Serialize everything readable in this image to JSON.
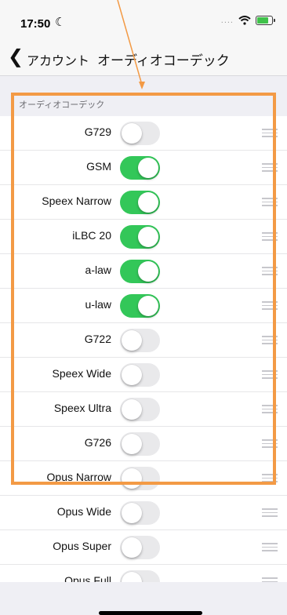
{
  "status_bar": {
    "time": "17:50",
    "moon_icon": "moon-icon",
    "signal_dots": "....",
    "wifi_icon": "wifi-icon",
    "battery_icon": "battery-icon",
    "battery_color": "#3fc14a"
  },
  "nav": {
    "back_label": "アカウント",
    "title": "オーディオコーデック"
  },
  "section": {
    "title": "オーディオコーデック"
  },
  "accent": {
    "switch_on": "#33c759",
    "highlight": "#f39a45"
  },
  "codecs": [
    {
      "name": "G729",
      "enabled": false
    },
    {
      "name": "GSM",
      "enabled": true
    },
    {
      "name": "Speex Narrow",
      "enabled": true
    },
    {
      "name": "iLBC 20",
      "enabled": true
    },
    {
      "name": "a-law",
      "enabled": true
    },
    {
      "name": "u-law",
      "enabled": true
    },
    {
      "name": "G722",
      "enabled": false
    },
    {
      "name": "Speex Wide",
      "enabled": false
    },
    {
      "name": "Speex Ultra",
      "enabled": false
    },
    {
      "name": "G726",
      "enabled": false
    },
    {
      "name": "Opus Narrow",
      "enabled": false
    },
    {
      "name": "Opus Wide",
      "enabled": false
    },
    {
      "name": "Opus Super",
      "enabled": false
    },
    {
      "name": "Opus Full",
      "enabled": false
    }
  ]
}
